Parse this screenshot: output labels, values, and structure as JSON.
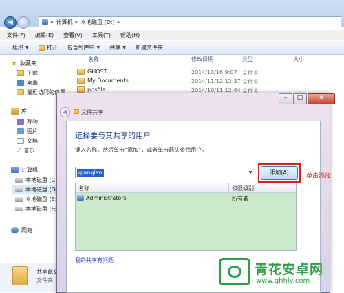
{
  "address": {
    "crumbs": [
      "计算机",
      "本地磁盘 (D:)"
    ]
  },
  "menu": [
    "文件(F)",
    "编辑(E)",
    "查看(V)",
    "工具(T)",
    "帮助(H)"
  ],
  "toolbar": {
    "organize": "组织",
    "open": "打开",
    "include": "包含到库中",
    "share": "共享",
    "new_folder": "新建文件夹"
  },
  "nav": {
    "favorites": "收藏夹",
    "downloads": "下载",
    "desktop": "桌面",
    "recent": "最近访问的位置",
    "libraries": "库",
    "videos": "视频",
    "pictures": "图片",
    "documents": "文档",
    "music": "音乐",
    "computer": "计算机",
    "drives": [
      "本地磁盘 (C:)",
      "本地磁盘 (D:)",
      "本地磁盘 (E:)",
      "本地磁盘 (F:)"
    ],
    "network": "网络"
  },
  "files": {
    "headers": {
      "name": "名称",
      "date": "修改日期",
      "type": "类型",
      "size": "大小"
    },
    "rows": [
      {
        "name": "GHOST",
        "date": "2014/10/16 9:07",
        "type": "文件夹"
      },
      {
        "name": "My Documents",
        "date": "2014/11/12 12:37",
        "type": "文件夹"
      },
      {
        "name": "ppsfile",
        "date": "2014/10/11 12:44",
        "type": "文件夹"
      }
    ]
  },
  "details": {
    "name": "共享此文",
    "type": "文件夹"
  },
  "dialog": {
    "title": "文件共享",
    "heading": "选择要与其共享的用户",
    "instruction": "键入名称，然后单击“添加”，或者单击箭头查找用户。",
    "input_value": "qianqian",
    "add_button": "添加(A)",
    "annotation": "单击添加",
    "table_headers": {
      "name": "名称",
      "permission": "权限级别"
    },
    "rows": [
      {
        "name": "Administrators",
        "permission": "所有者"
      }
    ],
    "problem_link": "我的共享有问题"
  },
  "watermark": {
    "brand": "青花安卓网",
    "url": "www.qhhlv.com"
  },
  "colors": {
    "accent": "#1e3e8c",
    "annotation": "#d01818",
    "table_bg": "#cbe9cc",
    "watermark": "#2f9e49"
  }
}
